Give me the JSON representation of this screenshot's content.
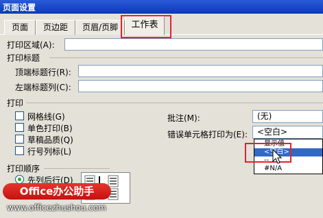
{
  "window": {
    "title": "页面设置"
  },
  "tabs": [
    {
      "label": "页面"
    },
    {
      "label": "页边距"
    },
    {
      "label": "页眉/页脚"
    },
    {
      "label": "工作表"
    }
  ],
  "print_area": {
    "label": "打印区域(A):",
    "value": ""
  },
  "print_titles": {
    "heading": "打印标题",
    "top_rows": {
      "label": "顶端标题行(R):",
      "value": ""
    },
    "left_cols": {
      "label": "左端标题列(C):",
      "value": ""
    }
  },
  "print_group": {
    "heading": "打印",
    "checkboxes": [
      {
        "label": "网格线(G)",
        "checked": false
      },
      {
        "label": "单色打印(B)",
        "checked": false
      },
      {
        "label": "草稿品质(Q)",
        "checked": false
      },
      {
        "label": "行号列标(L)",
        "checked": false
      }
    ],
    "comments": {
      "label": "批注(M):",
      "value": "(无)"
    },
    "cell_errors": {
      "label": "错误单元格打印为(E):",
      "value": "<空白>"
    },
    "error_options": [
      "显示值",
      "<空白>",
      "--",
      "#N/A"
    ],
    "selected_option": "<空白>"
  },
  "page_order": {
    "heading": "打印顺序",
    "options": [
      {
        "label": "先列后行(D)",
        "selected": true
      }
    ]
  },
  "watermark": {
    "brand": "Office办公助手",
    "url": "www.officezhushou.com"
  },
  "colors": {
    "highlight": "#e5202a",
    "selection": "#316ac5",
    "title_bar": "#0a3ab8"
  }
}
